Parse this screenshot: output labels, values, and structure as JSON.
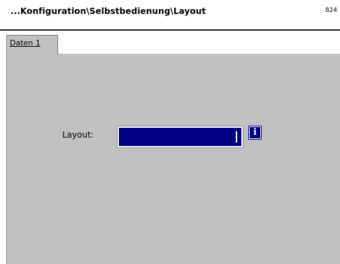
{
  "window": {
    "title": "...Konfiguration\\Selbstbedienung\\Layout",
    "screen_code": "824"
  },
  "tabs": [
    {
      "label": "Daten 1",
      "selected": true
    }
  ],
  "form": {
    "layout_label": "Layout:",
    "layout_value": "",
    "info_icon": "info-icon",
    "info_glyph": "i"
  },
  "colors": {
    "field_background": "#000080",
    "panel_background": "#c0c0c0"
  }
}
